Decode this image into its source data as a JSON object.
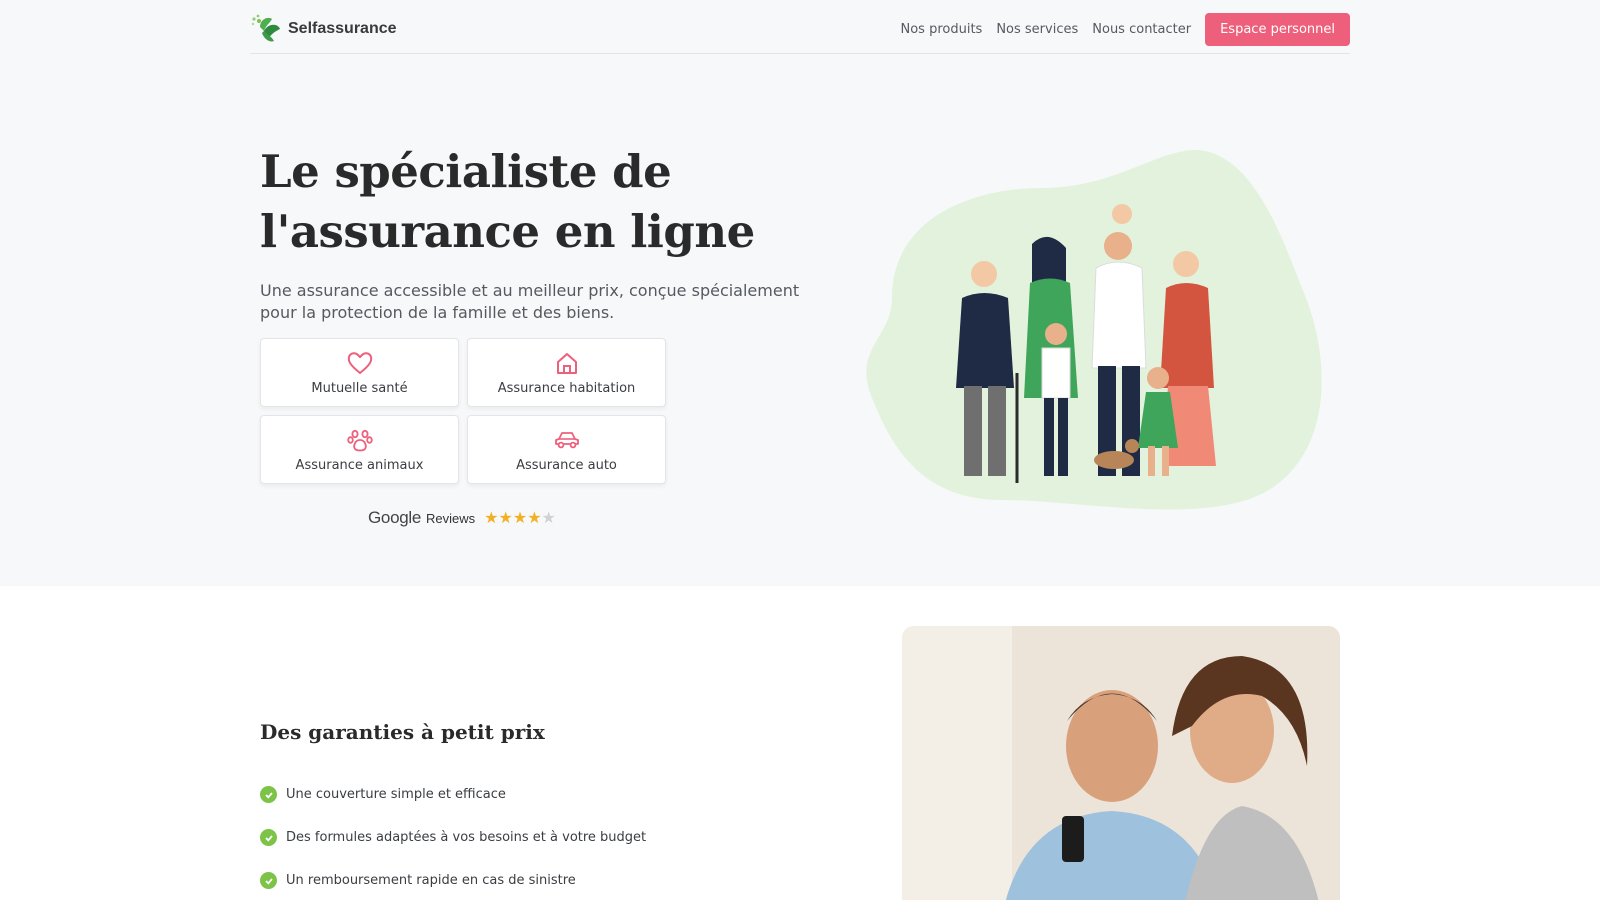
{
  "nav": {
    "brand": "Selfassurance",
    "links": [
      "Nos produits",
      "Nos services",
      "Nous contacter"
    ],
    "cta": "Espace personnel"
  },
  "hero": {
    "title_line1": "Le spécialiste de",
    "title_line2": "l'assurance en ligne",
    "subtitle": "Une assurance accessible et au meilleur prix, conçue spécialement pour la protection de la famille et des biens.",
    "cards": [
      {
        "label": "Mutuelle santé",
        "icon": "heart-icon"
      },
      {
        "label": "Assurance habitation",
        "icon": "house-icon"
      },
      {
        "label": "Assurance animaux",
        "icon": "paw-icon"
      },
      {
        "label": "Assurance auto",
        "icon": "car-icon"
      }
    ],
    "reviews": {
      "brand": "Google",
      "label": "Reviews",
      "rating": 4,
      "max": 5
    }
  },
  "section2": {
    "title": "Des garanties à petit prix",
    "features": [
      "Une couverture simple et efficace",
      "Des formules adaptées à vos besoins et à votre budget",
      "Un remboursement rapide en cas de sinistre"
    ]
  },
  "colors": {
    "accent": "#ee5f7b",
    "check": "#7cc348",
    "blob": "#e3f2dc",
    "brand_green": "#3f9b4c"
  }
}
